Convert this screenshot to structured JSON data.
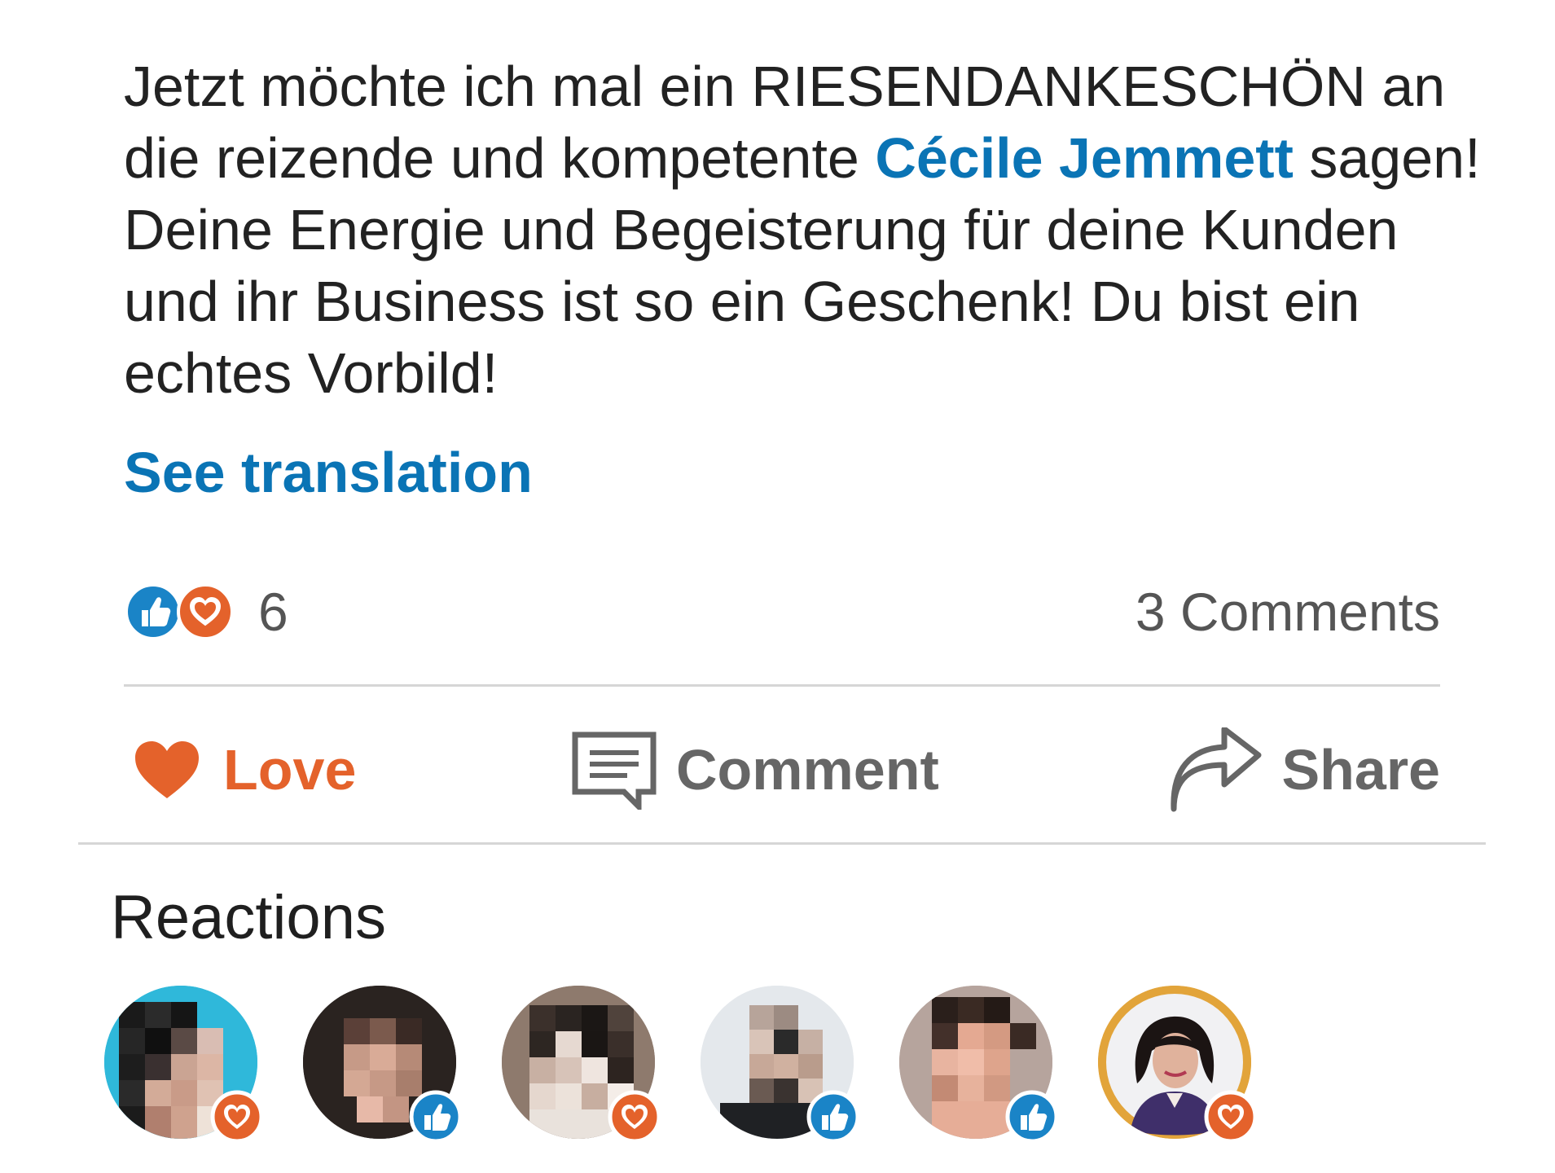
{
  "post": {
    "text_1": "Jetzt möchte ich mal ein RIESENDANKESCHÖN an die reizende und kompetente ",
    "mention": "Cécile Jemmett",
    "text_2": " sagen! Deine Energie und Begeisterung für deine Kunden und ihr Business ist so ein Geschenk! Du bist ein echtes Vorbild!",
    "see_translation": "See translation"
  },
  "social": {
    "reaction_count": "6",
    "comments": "3 Comments"
  },
  "actions": {
    "love": "Love",
    "comment": "Comment",
    "share": "Share"
  },
  "reactions": {
    "heading": "Reactions",
    "avatars": [
      {
        "reaction": "love-icon"
      },
      {
        "reaction": "like-icon"
      },
      {
        "reaction": "love-icon"
      },
      {
        "reaction": "like-icon"
      },
      {
        "reaction": "like-icon"
      },
      {
        "reaction": "love-icon"
      }
    ]
  },
  "colors": {
    "link": "#0a74b5",
    "love": "#e4622b",
    "like": "#1a84c7",
    "muted": "#666666"
  }
}
